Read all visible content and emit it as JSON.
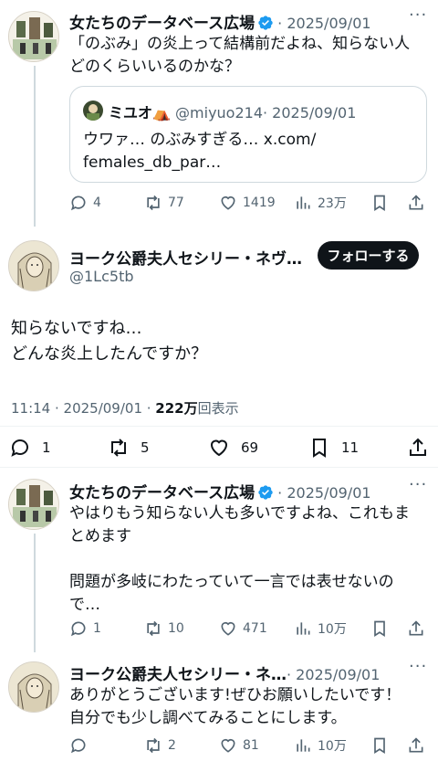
{
  "tweet1": {
    "author_name": "女たちのデータベース広場",
    "date": "· 2025/09/01",
    "text": "「のぶみ」の炎上って結構前だよね、知らない人\nどのくらいいるのかな？",
    "quote": {
      "author_name": "ミユオ⛺",
      "handle": "@miyuo214",
      "date": "· 2025/09/01",
      "text": "ウワァ… のぶみすぎる… x.com/\nfemales_db_par…"
    },
    "actions": {
      "replies": "4",
      "retweets": "77",
      "likes": "1419",
      "views": "23万"
    }
  },
  "main_tweet": {
    "author_name": "ヨーク公爵夫人セシリー・ネヴ…",
    "handle": "@1Lc5tb",
    "follow_label": "フォローする",
    "text": "知らないですね…\nどんな炎上したんですか？",
    "timestamp": "11:14 · 2025/09/01 · ",
    "views_count": "222万",
    "views_label": "回表示",
    "actions": {
      "replies": "1",
      "retweets": "5",
      "likes": "69",
      "bookmarks": "11"
    }
  },
  "tweet3": {
    "author_name": "女たちのデータベース広場",
    "date": "· 2025/09/01",
    "text": "やはりもう知らない人も多いですよね、これもま\nとめます\n\n問題が多岐にわたっていて一言では表せないの\nで…",
    "actions": {
      "replies": "1",
      "retweets": "10",
      "likes": "471",
      "views": "10万"
    }
  },
  "tweet4": {
    "author_name": "ヨーク公爵夫人セシリー・ネ…",
    "date": "· 2025/09/01",
    "text": "ありがとうございます!ぜひお願いしたいです！\n自分でも少し調べてみることにします。",
    "actions": {
      "replies": "",
      "retweets": "2",
      "likes": "81",
      "views": "10万"
    }
  },
  "colors": {
    "text": "#0f1419",
    "muted": "#536471",
    "verified": "#1d9bf0",
    "border": "#cfd9de",
    "follow_bg": "#0f1419"
  },
  "icons": [
    "reply-icon",
    "retweet-icon",
    "like-icon",
    "views-icon",
    "bookmark-icon",
    "share-icon",
    "verified-badge-icon",
    "more-icon"
  ]
}
